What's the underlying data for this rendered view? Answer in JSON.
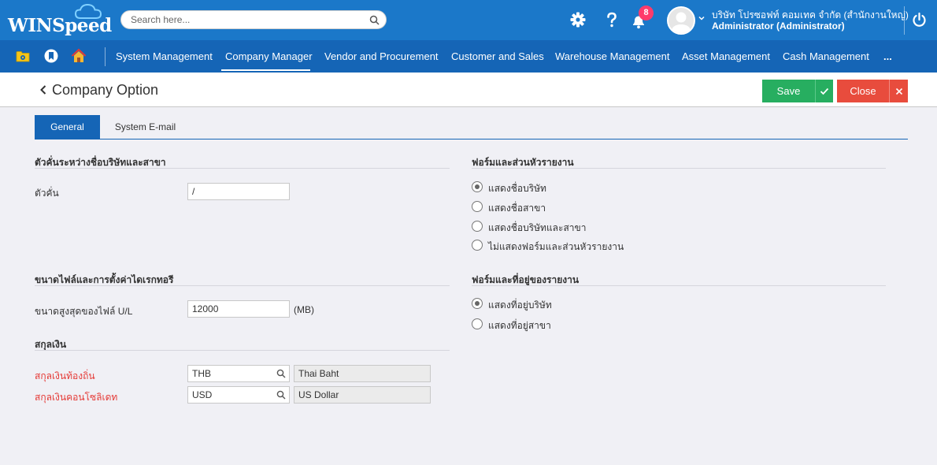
{
  "header": {
    "logo_text": "WINSpeed",
    "search_placeholder": "Search here...",
    "notification_count": "8",
    "company": "บริษัท โปรซอฟท์ คอมเทค จำกัด (สำนักงานใหญ่)",
    "user": "Administrator (Administrator)"
  },
  "menu": {
    "items": [
      "System Management",
      "Company Manager",
      "Vendor and Procurement",
      "Customer and Sales",
      "Warehouse Management",
      "Asset Management",
      "Cash Management",
      "..."
    ],
    "active": "Company Manager"
  },
  "page": {
    "title": "Company Option",
    "save_label": "Save",
    "close_label": "Close"
  },
  "tabs": {
    "general": "General",
    "email": "System E-mail"
  },
  "separator_section": {
    "title": "ตัวคั่นระหว่างชื่อบริษัทและสาขา",
    "label": "ตัวคั่น",
    "value": "/"
  },
  "file_section": {
    "title": "ขนาดไฟล์และการตั้งค่าไดเรกทอรี",
    "label": "ขนาดสูงสุดของไฟล์ U/L",
    "value": "12000",
    "unit": "(MB)"
  },
  "currency_section": {
    "title": "สกุลเงิน",
    "local_label": "สกุลเงินท้องถิ่น",
    "local_code": "THB",
    "local_name": "Thai Baht",
    "consolidate_label": "สกุลเงินคอนโซลิเดท",
    "consolidate_code": "USD",
    "consolidate_name": "US Dollar"
  },
  "form_header_section": {
    "title": "ฟอร์มและส่วนหัวรายงาน",
    "options": [
      "แสดงชื่อบริษัท",
      "แสดงชื่อสาขา",
      "แสดงชื่อบริษัทและสาขา",
      "ไม่แสดงฟอร์มและส่วนหัวรายงาน"
    ],
    "selected": 0
  },
  "form_address_section": {
    "title": "ฟอร์มและที่อยู่ของรายงาน",
    "options": [
      "แสดงที่อยู่บริษัท",
      "แสดงที่อยู่สาขา"
    ],
    "selected": 0
  },
  "colors": {
    "header_blue": "#1b78c9",
    "menu_blue": "#1565b6",
    "save_green": "#27ae60",
    "close_red": "#e84c3d",
    "required_red": "#e53935"
  }
}
